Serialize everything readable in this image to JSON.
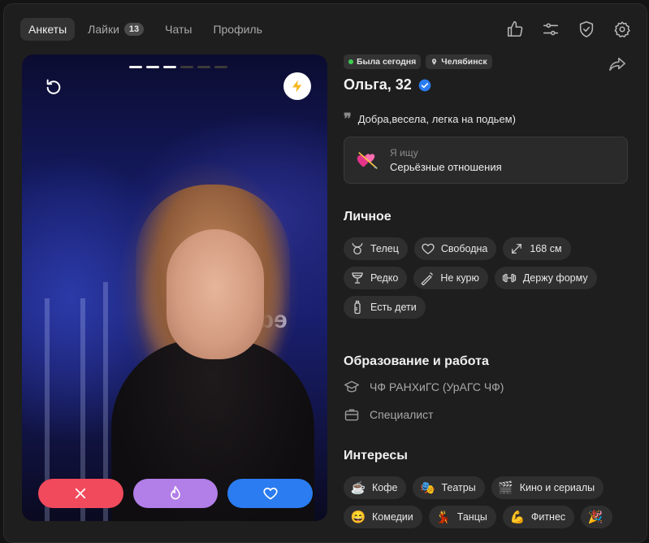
{
  "nav": {
    "tabs": [
      {
        "label": "Анкеты",
        "active": true
      },
      {
        "label": "Лайки",
        "count": "13"
      },
      {
        "label": "Чаты"
      },
      {
        "label": "Профиль"
      }
    ],
    "icons": [
      "thumbs-up-icon",
      "filter-sliders-icon",
      "shield-check-icon",
      "settings-gear-icon"
    ]
  },
  "photo": {
    "pages_total": 6,
    "pages_viewed": 3,
    "sign_text": "eda"
  },
  "actions": [
    "dislike-button",
    "super-like-button",
    "like-button"
  ],
  "profile": {
    "status": "Была сегодня",
    "city": "Челябинск",
    "name": "Ольга, 32",
    "verified": true,
    "bio": "Добра,весела, легка на подьем)",
    "seeking_label": "Я ищу",
    "seeking_value": "Серьёзные отношения"
  },
  "personal": {
    "title": "Личное",
    "chips": [
      {
        "icon": "taurus-icon",
        "label": "Телец"
      },
      {
        "icon": "heart-outline-icon",
        "label": "Свободна"
      },
      {
        "icon": "height-arrows-icon",
        "label": "168 см"
      },
      {
        "icon": "wine-glass-icon",
        "label": "Редко"
      },
      {
        "icon": "no-smoking-icon",
        "label": "Не курю"
      },
      {
        "icon": "dumbbell-icon",
        "label": "Держу форму"
      },
      {
        "icon": "baby-bottle-icon",
        "label": "Есть дети"
      }
    ]
  },
  "education": {
    "title": "Образование и работа",
    "university": "ЧФ РАНХиГС (УрАГС ЧФ)",
    "job": "Специалист"
  },
  "interests": {
    "title": "Интересы",
    "chips": [
      {
        "emoji": "☕",
        "label": "Кофе"
      },
      {
        "emoji": "🎭",
        "label": "Театры"
      },
      {
        "emoji": "🎬",
        "label": "Кино и сериалы"
      },
      {
        "emoji": "😄",
        "label": "Комедии"
      },
      {
        "emoji": "💃",
        "label": "Танцы"
      },
      {
        "emoji": "💪",
        "label": "Фитнес"
      }
    ]
  },
  "colors": {
    "dislike": "#f14a5c",
    "super": "#b27ee8",
    "like": "#2a7cf0",
    "online": "#3ecf55",
    "verified": "#2a7cf0"
  }
}
